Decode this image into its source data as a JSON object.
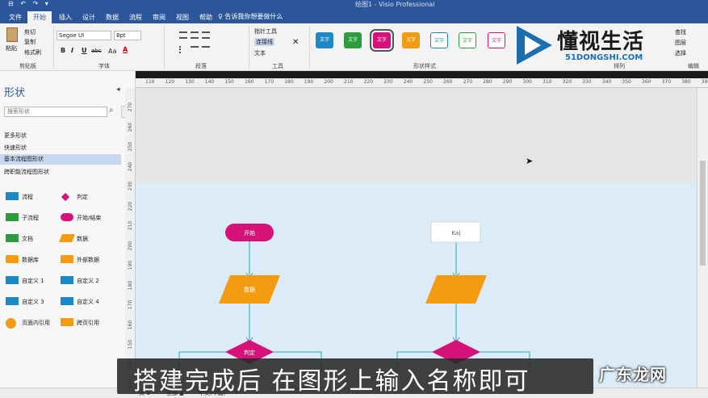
{
  "titlebar": {
    "app_title": "绘图1 - Visio Professional",
    "qat": "⊟ ↶ ↷ ▾"
  },
  "tabs": [
    {
      "label": "文件"
    },
    {
      "label": "开始"
    },
    {
      "label": "插入"
    },
    {
      "label": "设计"
    },
    {
      "label": "数据"
    },
    {
      "label": "流程"
    },
    {
      "label": "审阅"
    },
    {
      "label": "视图"
    },
    {
      "label": "帮助"
    }
  ],
  "tell_me": "♀ 告诉我你想要做什么",
  "ribbon": {
    "clipboard": {
      "paste": "粘贴",
      "cut": "剪切",
      "copy": "复制",
      "format_painter": "格式刷",
      "group": "剪贴板"
    },
    "font": {
      "family": "Segoe UI",
      "size": "8pt",
      "bold": "B",
      "italic": "I",
      "underline": "U",
      "strike": "abc",
      "case": "Aa",
      "color": "A",
      "group": "字体"
    },
    "paragraph": {
      "group": "段落"
    },
    "tools": {
      "pointer": "指针工具",
      "connector": "连接线",
      "text": "文本",
      "group": "工具"
    },
    "shape_styles": {
      "group": "形状样式",
      "swatch_label": "文字"
    },
    "arrange": {
      "group": "排列"
    },
    "editing": {
      "find": "查找",
      "layer": "图层",
      "select": "选择",
      "group": "编辑"
    }
  },
  "watermark": {
    "text": "懂视生活",
    "url": "51DONGSHI.COM"
  },
  "shapes_panel": {
    "title": "形状",
    "search_placeholder": "搜索形状",
    "links": [
      "更多形状",
      "快速形状",
      "基本流程图形状",
      "跨职能流程图形状"
    ],
    "stencil": [
      {
        "label": "流程",
        "color": "#1e88c7",
        "icon": "process-shape-icon"
      },
      {
        "label": "判定",
        "color": "#d6127a",
        "icon": "decision-shape-icon"
      },
      {
        "label": "子流程",
        "color": "#2e9c3e",
        "icon": "subprocess-shape-icon"
      },
      {
        "label": "开始/结束",
        "color": "#d6127a",
        "icon": "terminator-shape-icon"
      },
      {
        "label": "文档",
        "color": "#2e9c3e",
        "icon": "document-shape-icon"
      },
      {
        "label": "数据",
        "color": "#f39c12",
        "icon": "data-shape-icon"
      },
      {
        "label": "数据库",
        "color": "#f39c12",
        "icon": "database-shape-icon"
      },
      {
        "label": "外部数据",
        "color": "#f39c12",
        "icon": "external-data-shape-icon"
      },
      {
        "label": "自定义 1",
        "color": "#1e88c7",
        "icon": "custom1-shape-icon"
      },
      {
        "label": "自定义 2",
        "color": "#1e88c7",
        "icon": "custom2-shape-icon"
      },
      {
        "label": "自定义 3",
        "color": "#1e88c7",
        "icon": "custom3-shape-icon"
      },
      {
        "label": "自定义 4",
        "color": "#1e88c7",
        "icon": "custom4-shape-icon"
      },
      {
        "label": "页面内引用",
        "color": "#f39c12",
        "icon": "onpage-ref-shape-icon"
      },
      {
        "label": "跨页引用",
        "color": "#f39c12",
        "icon": "offpage-ref-shape-icon"
      }
    ]
  },
  "ruler": {
    "top": [
      "110",
      "120",
      "130",
      "140",
      "150",
      "160",
      "170",
      "180",
      "190",
      "200",
      "210",
      "220",
      "230",
      "240",
      "250",
      "260",
      "270",
      "280",
      "290",
      "300",
      "310",
      "320",
      "330",
      "340",
      "350",
      "360",
      "370",
      "380",
      "390"
    ],
    "left": [
      "270",
      "260",
      "250",
      "240",
      "230",
      "220",
      "210",
      "200",
      "190",
      "180",
      "170",
      "160",
      "150",
      "140",
      "130"
    ]
  },
  "diagram": {
    "start_label": "开始",
    "data_label": "数据",
    "decision_label": "判定",
    "right_box_label": "Ka|",
    "colors": {
      "start": "#d6127a",
      "data": "#f39c12",
      "decision": "#d6127a",
      "connector": "#2aa7bf"
    }
  },
  "statusbar": {
    "page": "页-1",
    "all": "全部 ▲",
    "lang": "中文(中国)",
    "plus": "+"
  },
  "subtitle": "搭建完成后 在图形上输入名称即可",
  "brand": "广东龙网"
}
